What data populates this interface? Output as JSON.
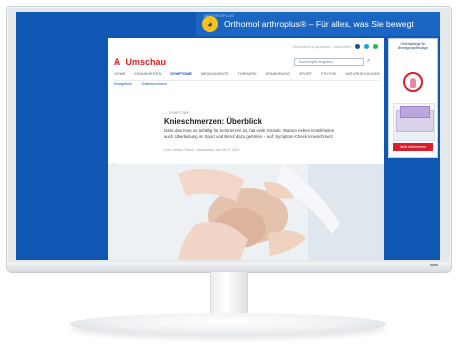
{
  "top_banner": {
    "small_label": "ARTHROPLUS",
    "text": "Orthomol arthroplus® – Für alles, was Sie bewegt"
  },
  "site": {
    "logo": "Umschau",
    "utility_text": "Gesundheit & Apotheke – Newsletter",
    "search_placeholder": "Suchbegriff eingeben",
    "nav": [
      "HOME",
      "KRANKHEITEN",
      "SYMPTOME",
      "MEDIKAMENTE",
      "THERAPIE",
      "ERNÄHRUNG",
      "SPORT",
      "PSYCHE",
      "NATURHEILKUNDE"
    ],
    "subnav": [
      "Kniegelenk",
      "Gelenkschmerz"
    ]
  },
  "article": {
    "kicker": "— SYMPTOME",
    "headline": "Knieschmerzen: Überblick",
    "teaser": "Dass das Knie so anfällig für Schmerzen ist, hat viele Gründe. Warum neben Krankheiten auch Überlastung im Sport und Beruf dazu gehören – auf: Symptom-Check Knieschmerz",
    "credit": "Foto: Adobe Stock – Aktualisiert am 08.07.2021"
  },
  "right_ad": {
    "title": "Gelenkpflege für Bewegungsfreudige",
    "button": "Jetzt informieren"
  },
  "colors": {
    "screen_blue": "#0f57b3",
    "brand_red": "#d81f26",
    "link_blue": "#174ea6"
  },
  "icons": {
    "search": "search-icon",
    "zoom": "zoom-icon",
    "social": [
      "facebook-icon",
      "twitter-icon",
      "instagram-icon"
    ]
  }
}
